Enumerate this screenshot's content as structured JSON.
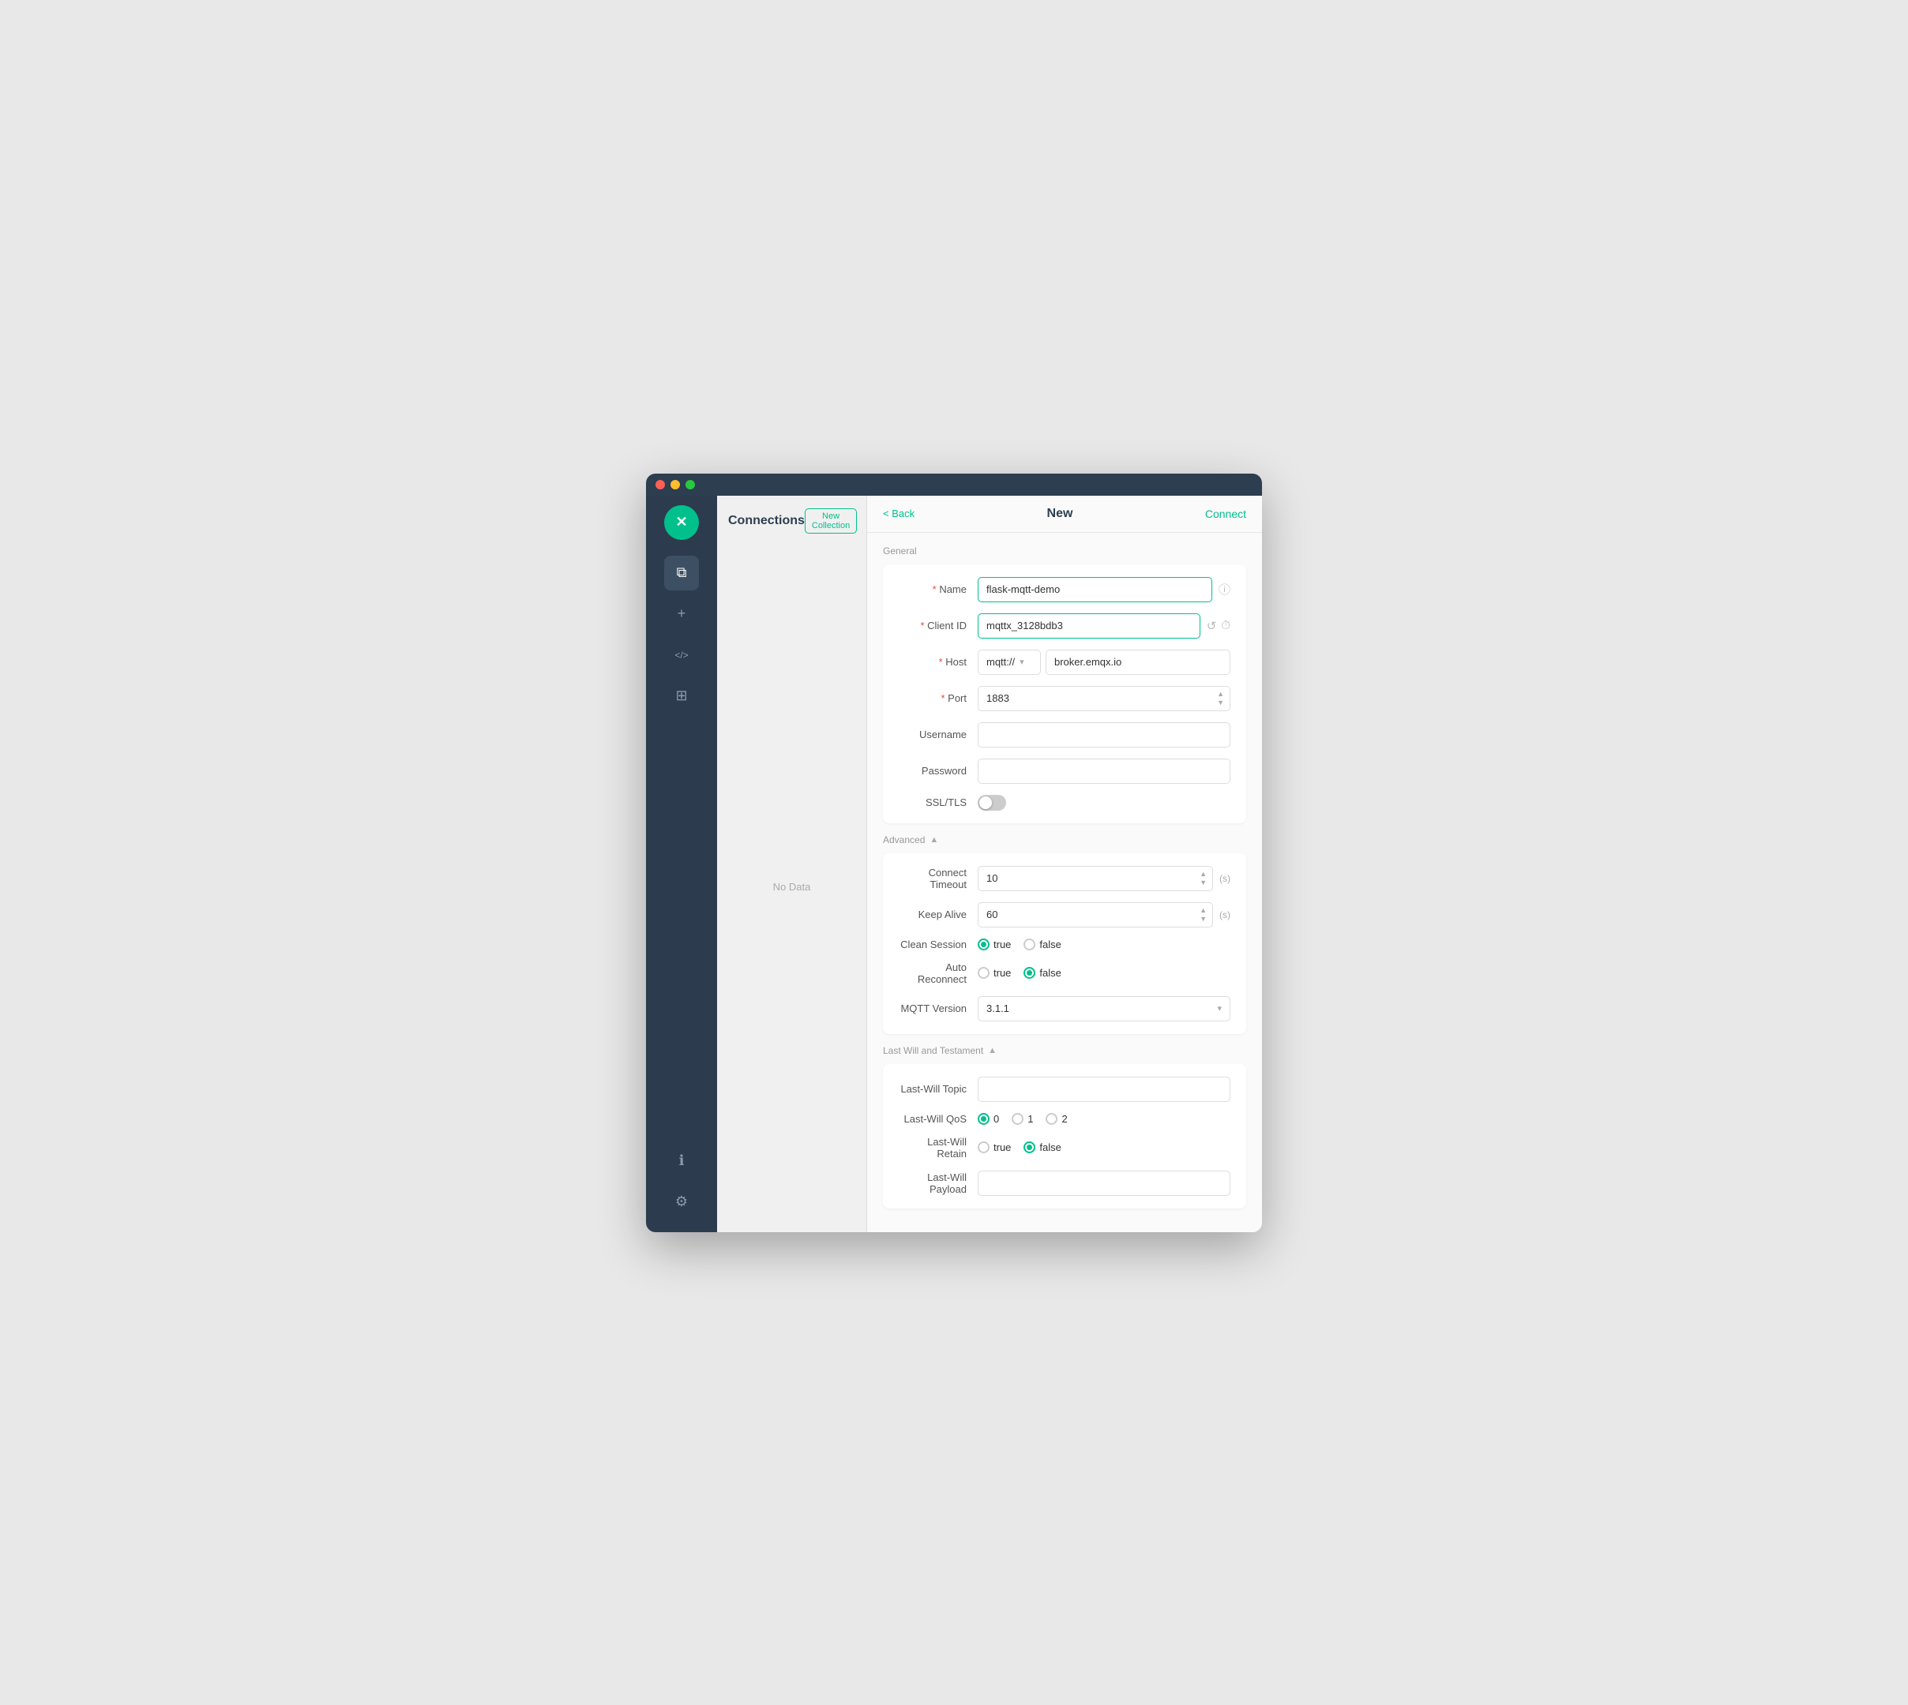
{
  "window": {
    "titlebar": {
      "dots": [
        "red",
        "yellow",
        "green"
      ]
    }
  },
  "sidebar": {
    "logo_icon": "✕",
    "icons": [
      {
        "id": "connections",
        "symbol": "⧉",
        "active": true
      },
      {
        "id": "add",
        "symbol": "+"
      },
      {
        "id": "code",
        "symbol": "</>"
      },
      {
        "id": "table",
        "symbol": "⊞"
      }
    ],
    "bottom_icons": [
      {
        "id": "info",
        "symbol": "ℹ"
      },
      {
        "id": "settings",
        "symbol": "⚙"
      }
    ]
  },
  "connections_panel": {
    "title": "Connections",
    "new_collection_btn": "New Collection",
    "no_data": "No Data"
  },
  "main": {
    "back_label": "< Back",
    "title": "New",
    "connect_label": "Connect"
  },
  "general": {
    "section_label": "General",
    "name": {
      "label": "Name",
      "required": true,
      "value": "flask-mqtt-demo"
    },
    "client_id": {
      "label": "Client ID",
      "required": true,
      "value": "mqttx_3128bdb3"
    },
    "host": {
      "label": "Host",
      "required": true,
      "protocol": "mqtt://",
      "address": "broker.emqx.io"
    },
    "port": {
      "label": "Port",
      "required": true,
      "value": "1883"
    },
    "username": {
      "label": "Username",
      "value": ""
    },
    "password": {
      "label": "Password",
      "value": ""
    },
    "ssl_tls": {
      "label": "SSL/TLS",
      "enabled": false
    }
  },
  "advanced": {
    "section_label": "Advanced",
    "toggle_symbol": "▲",
    "connect_timeout": {
      "label": "Connect Timeout",
      "value": "10",
      "unit": "(s)"
    },
    "keep_alive": {
      "label": "Keep Alive",
      "value": "60",
      "unit": "(s)"
    },
    "clean_session": {
      "label": "Clean Session",
      "options": [
        "true",
        "false"
      ],
      "selected": "true"
    },
    "auto_reconnect": {
      "label": "Auto Reconnect",
      "options": [
        "true",
        "false"
      ],
      "selected": "false"
    },
    "mqtt_version": {
      "label": "MQTT Version",
      "value": "3.1.1"
    }
  },
  "last_will": {
    "section_label": "Last Will and Testament",
    "toggle_symbol": "▲",
    "last_will_topic": {
      "label": "Last-Will Topic",
      "value": ""
    },
    "last_will_qos": {
      "label": "Last-Will QoS",
      "options": [
        "0",
        "1",
        "2"
      ],
      "selected": "0"
    },
    "last_will_retain": {
      "label": "Last-Will Retain",
      "options": [
        "true",
        "false"
      ],
      "selected": "false"
    },
    "last_will_payload": {
      "label": "Last-Will Payload",
      "value": ""
    }
  },
  "colors": {
    "accent": "#00c08b",
    "sidebar_bg": "#2d3b4e",
    "text_dark": "#2c3e50",
    "text_muted": "#999"
  }
}
